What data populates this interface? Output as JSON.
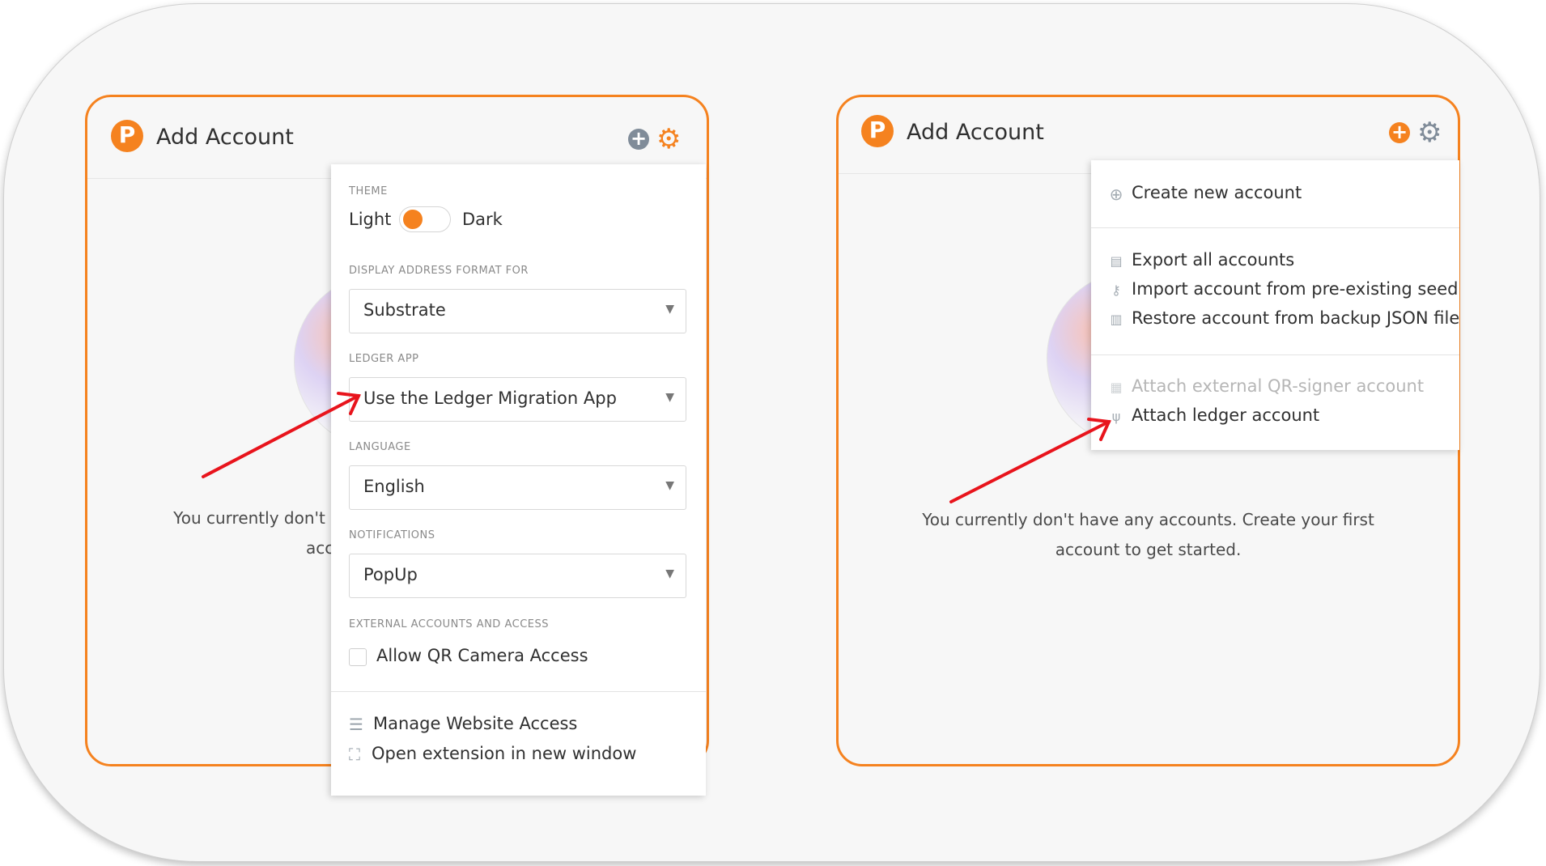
{
  "left": {
    "title": "Add Account",
    "logo_letter": "P",
    "add_symbol": "+",
    "empty_line1": "You currently don't",
    "empty_line2": "acc",
    "settings": {
      "theme_label": "THEME",
      "theme_light": "Light",
      "theme_dark": "Dark",
      "address_label": "DISPLAY ADDRESS FORMAT FOR",
      "address_value": "Substrate",
      "ledger_label": "LEDGER APP",
      "ledger_value": "Use the Ledger Migration App",
      "language_label": "LANGUAGE",
      "language_value": "English",
      "notifications_label": "NOTIFICATIONS",
      "notifications_value": "PopUp",
      "external_label": "EXTERNAL ACCOUNTS AND ACCESS",
      "qr_camera": "Allow QR Camera Access",
      "manage_access": "Manage Website Access",
      "open_window": "Open extension in new window",
      "caret": "▼"
    }
  },
  "right": {
    "title": "Add Account",
    "logo_letter": "P",
    "add_symbol": "+",
    "empty_line1": "You currently don't have any accounts. Create your first",
    "empty_line2": "account to get started.",
    "menu": {
      "create": "Create new account",
      "export": "Export all accounts",
      "import_seed": "Import account from pre-existing seed",
      "restore": "Restore account from backup JSON file",
      "attach_qr": "Attach external QR-signer account",
      "attach_ledger": "Attach ledger account"
    }
  },
  "colors": {
    "accent": "#f5821f",
    "annotation_arrow": "#e8141c"
  }
}
